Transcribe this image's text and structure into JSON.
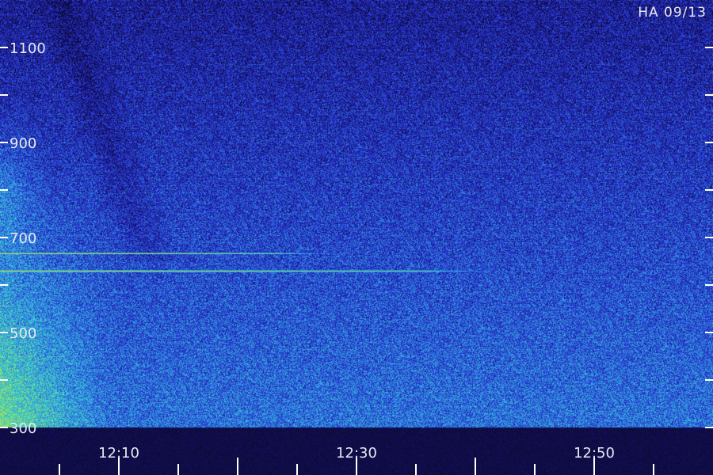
{
  "chart_data": {
    "type": "heatmap",
    "title": "HA 09/13",
    "xlabel": "",
    "ylabel": "",
    "x_tick_labels": [
      "12:10",
      "12:30",
      "12:50"
    ],
    "y_tick_labels": [
      "300",
      "500",
      "700",
      "900",
      "1100"
    ],
    "x_range_minutes": [
      "12:00",
      "13:00"
    ],
    "y_range": [
      300,
      1200
    ],
    "colormap": [
      "#0a0820",
      "#1a1690",
      "#2a3ad8",
      "#2f8fe0",
      "#3ad0d0",
      "#8fe860",
      "#f0d020",
      "#f06010"
    ],
    "features": [
      {
        "kind": "narrow-band-line",
        "y": 667,
        "x_start": "12:00",
        "x_end": "12:23",
        "peak_color": "#8fe860"
      },
      {
        "kind": "narrow-band-line",
        "y": 630,
        "x_start": "12:00",
        "x_end": "12:36",
        "peak_color": "#f0d020"
      },
      {
        "kind": "broadband-enhancement",
        "y_range": [
          300,
          900
        ],
        "x_range": [
          "12:00",
          "12:07"
        ]
      },
      {
        "kind": "noise-floor",
        "y_range": [
          300,
          400
        ],
        "x_range": [
          "12:00",
          "13:00"
        ]
      }
    ]
  }
}
